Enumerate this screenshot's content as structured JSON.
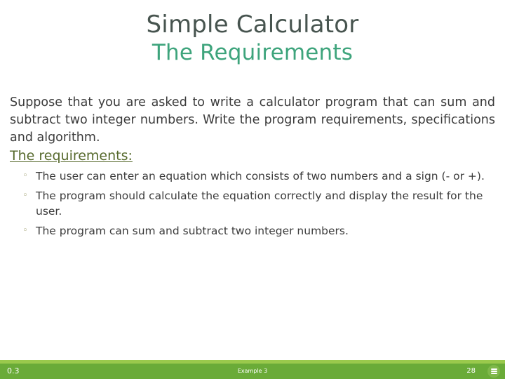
{
  "slide": {
    "title_line1": "Simple Calculator",
    "title_line2": "The Requirements",
    "body_paragraph": "Suppose that you are asked to write a calculator program that can sum and subtract two integer numbers. Write the program requirements, specifications and algorithm.",
    "requirements_heading": "The requirements:",
    "bullet_marker": "◦",
    "bullets": [
      "The user can enter an equation which consists of two numbers and a sign (- or +).",
      "The program should calculate the equation correctly and display the result for the user.",
      "The program can sum and subtract two integer numbers."
    ]
  },
  "footer": {
    "version": "0.3",
    "center_label": "Example 3",
    "page_number": "28",
    "menu_icon": "menu-icon"
  },
  "colors": {
    "title_primary": "#47544f",
    "title_accent": "#3ea47c",
    "heading_green": "#56692c",
    "body_text": "#3b3b3b",
    "bullet_marker": "#9a9a6a",
    "footer_strip": "#9ac94c",
    "footer_bar": "#6aab38",
    "footer_text": "#ffffff",
    "background": "#ffffff"
  }
}
